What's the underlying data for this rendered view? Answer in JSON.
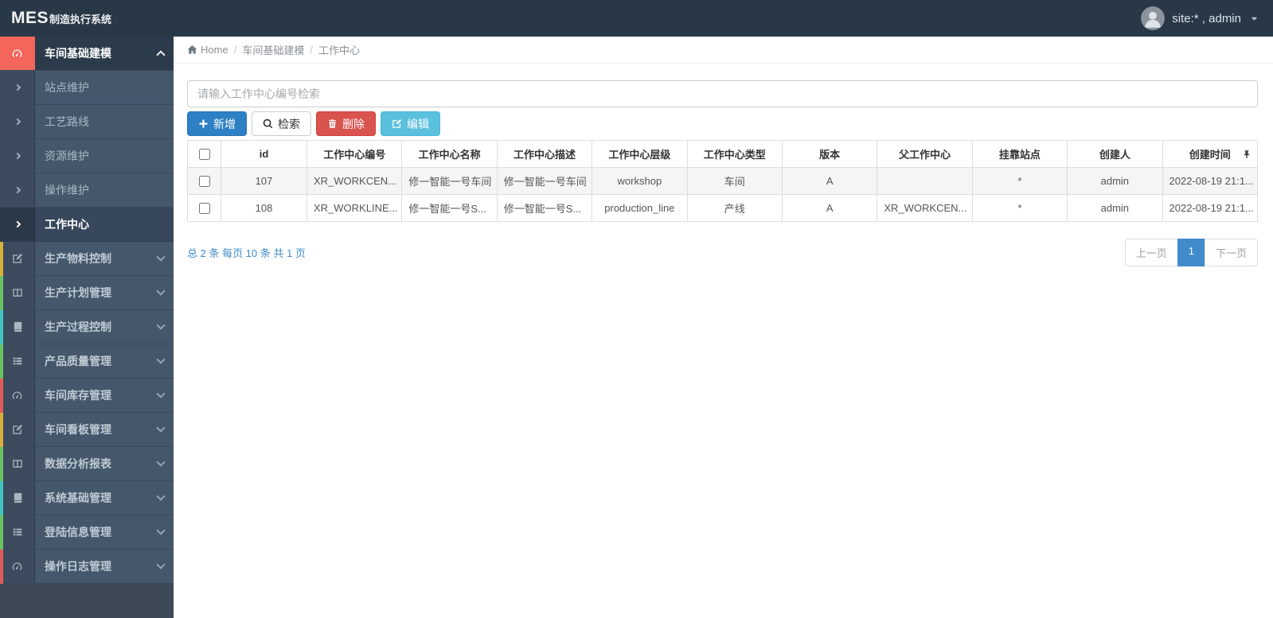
{
  "navbar": {
    "logo_mes": "MES",
    "logo_subtitle": "制造执行系统",
    "user_label": "site:* , admin",
    "avatar_icon": "user-avatar",
    "caret_icon": "caret-down-icon"
  },
  "breadcrumb": {
    "home_icon": "home-icon",
    "home": "Home",
    "separator": "/",
    "items": [
      "车间基础建模",
      "工作中心"
    ]
  },
  "sidebar": {
    "items": [
      {
        "label": "车间基础建模",
        "icon": "gauge-icon",
        "active": true,
        "expanded": true,
        "strip_color": "#f4655c",
        "children": [
          {
            "label": "站点维护",
            "active": false
          },
          {
            "label": "工艺路线",
            "active": false
          },
          {
            "label": "资源维护",
            "active": false
          },
          {
            "label": "操作维护",
            "active": false
          },
          {
            "label": "工作中心",
            "active": true
          }
        ]
      },
      {
        "label": "生产物料控制",
        "icon": "pencil-square-icon",
        "active": false,
        "expanded": false,
        "strip_color": "#d9b03c"
      },
      {
        "label": "生产计划管理",
        "icon": "columns-icon",
        "active": false,
        "expanded": false,
        "strip_color": "#69c262"
      },
      {
        "label": "生产过程控制",
        "icon": "book-icon",
        "active": false,
        "expanded": false,
        "strip_color": "#41c5c0"
      },
      {
        "label": "产品质量管理",
        "icon": "list-icon",
        "active": false,
        "expanded": false,
        "strip_color": "#69c262"
      },
      {
        "label": "车间库存管理",
        "icon": "gauge-icon",
        "active": false,
        "expanded": false,
        "strip_color": "#e35b56"
      },
      {
        "label": "车间看板管理",
        "icon": "pencil-square-icon",
        "active": false,
        "expanded": false,
        "strip_color": "#d9b03c"
      },
      {
        "label": "数据分析报表",
        "icon": "columns-icon",
        "active": false,
        "expanded": false,
        "strip_color": "#69c262"
      },
      {
        "label": "系统基础管理",
        "icon": "book-icon",
        "active": false,
        "expanded": false,
        "strip_color": "#41c5c0"
      },
      {
        "label": "登陆信息管理",
        "icon": "list-icon",
        "active": false,
        "expanded": false,
        "strip_color": "#69c262"
      },
      {
        "label": "操作日志管理",
        "icon": "gauge-icon",
        "active": false,
        "expanded": false,
        "strip_color": "#e35b56"
      }
    ]
  },
  "toolbar": {
    "search_placeholder": "请输入工作中心编号检索",
    "buttons": [
      {
        "name": "add-button",
        "label": "新增",
        "style": "primary",
        "icon": "plus-icon"
      },
      {
        "name": "search-button",
        "label": "检索",
        "style": "default",
        "icon": "search-icon"
      },
      {
        "name": "delete-button",
        "label": "删除",
        "style": "danger",
        "icon": "trash-icon"
      },
      {
        "name": "edit-button",
        "label": "编辑",
        "style": "info",
        "icon": "edit-icon"
      }
    ]
  },
  "table": {
    "pin_icon": "pin-icon",
    "columns": [
      "id",
      "工作中心编号",
      "工作中心名称",
      "工作中心描述",
      "工作中心层级",
      "工作中心类型",
      "版本",
      "父工作中心",
      "挂靠站点",
      "创建人",
      "创建时间"
    ],
    "rows": [
      {
        "checked": false,
        "cells": [
          "107",
          "XR_WORKCEN...",
          "修一智能一号车间",
          "修一智能一号车间",
          "workshop",
          "车间",
          "A",
          "",
          "*",
          "admin",
          "2022-08-19 21:1..."
        ]
      },
      {
        "checked": false,
        "cells": [
          "108",
          "XR_WORKLINE...",
          "修一智能一号S...",
          "修一智能一号S...",
          "production_line",
          "产线",
          "A",
          "XR_WORKCEN...",
          "*",
          "admin",
          "2022-08-19 21:1..."
        ]
      }
    ]
  },
  "pagination": {
    "summary": "总 2 条  每页 10 条  共 1 页",
    "prev": "上一页",
    "page": "1",
    "next": "下一页"
  },
  "colors": {
    "navbar_bg": "#293846",
    "sidebar_bg": "#45576b",
    "active_icon_block": "#f4655c",
    "accent_blue": "#428bca",
    "primary_button": "#2e80c4",
    "danger_button": "#d9534f",
    "info_button": "#5bc0de"
  }
}
